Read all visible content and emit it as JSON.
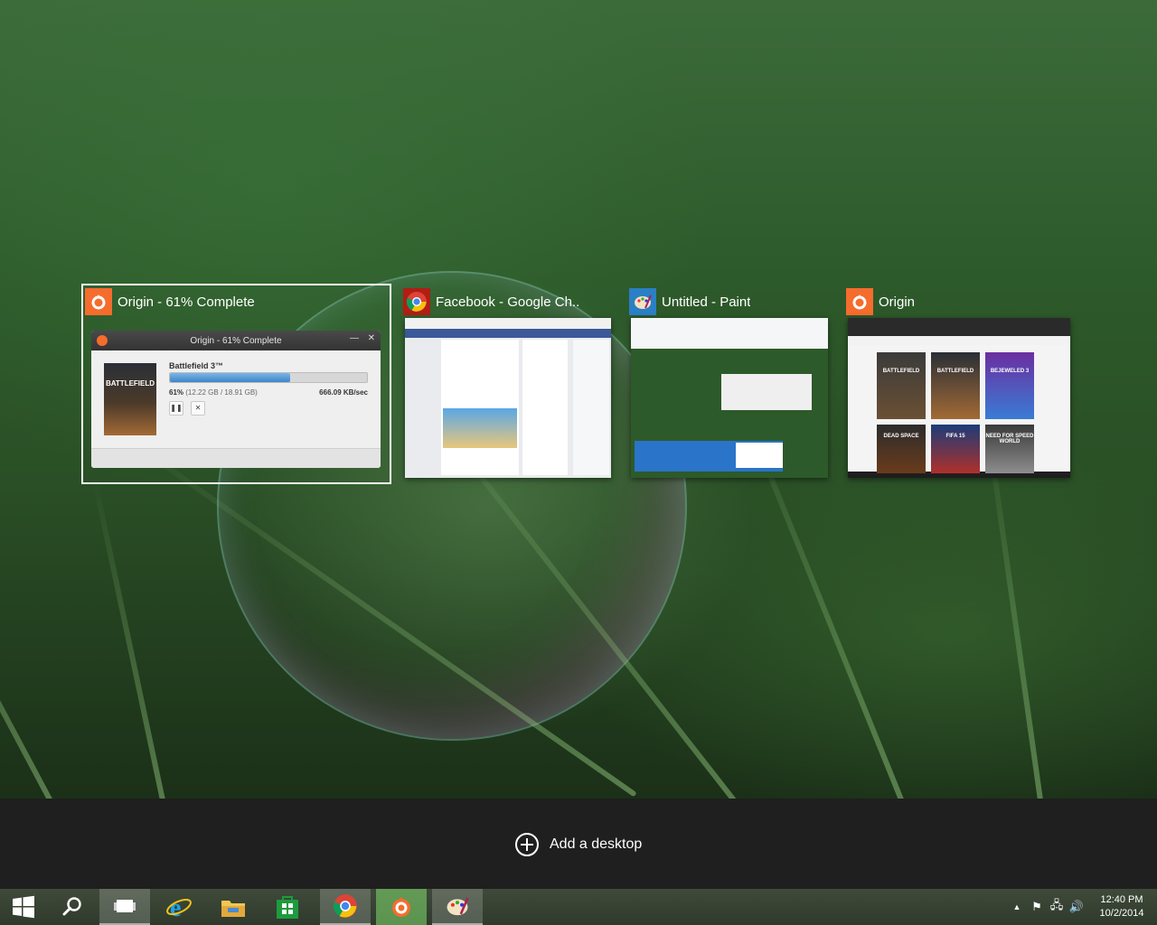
{
  "task_view": {
    "windows": [
      {
        "title": "Origin - 61% Complete",
        "app": "Origin",
        "selected": true
      },
      {
        "title": "Facebook - Google Ch...",
        "app": "Google Chrome",
        "selected": false
      },
      {
        "title": "Untitled - Paint",
        "app": "Paint",
        "selected": false
      },
      {
        "title": "Origin",
        "app": "Origin",
        "selected": false
      }
    ],
    "origin_dialog": {
      "title": "Origin - 61% Complete",
      "game": "Battlefield 3™",
      "cover_text": "BATTLEFIELD",
      "percent_text": "61%",
      "size_text": "(12.22 GB / 18.91 GB)",
      "speed": "666.09 KB/sec",
      "progress": 0.61,
      "min_glyph": "—",
      "close_glyph": "✕",
      "pause_glyph": "❚❚",
      "cancel_glyph": "✕"
    },
    "origin_library": {
      "covers": [
        "BATTLEFIELD",
        "BATTLEFIELD",
        "BEJEWELED 3",
        "DEAD SPACE",
        "FIFA 15",
        "NEED FOR SPEED WORLD"
      ]
    }
  },
  "add_desktop": {
    "label": "Add a desktop"
  },
  "taskbar": {
    "items": [
      {
        "name": "start",
        "icon": "windows-logo-icon"
      },
      {
        "name": "search",
        "icon": "search-icon"
      },
      {
        "name": "task-view",
        "icon": "task-view-icon"
      },
      {
        "name": "internet-explorer",
        "icon": "internet-explorer-icon"
      },
      {
        "name": "file-explorer",
        "icon": "folder-icon"
      },
      {
        "name": "store",
        "icon": "store-icon"
      },
      {
        "name": "chrome",
        "icon": "chrome-icon"
      },
      {
        "name": "origin",
        "icon": "origin-icon"
      },
      {
        "name": "paint",
        "icon": "paint-icon"
      }
    ],
    "tray": {
      "time": "12:40 PM",
      "date": "10/2/2014",
      "show_hidden_glyph": "▲",
      "flag_glyph": "⚑",
      "network_glyph": "🖧",
      "volume_glyph": "🔊"
    }
  },
  "colors": {
    "origin_orange": "#f56c2d",
    "taskbar": "#2f3a2c",
    "add_bar": "#1f1f1f",
    "store_green": "#1e9b3e"
  }
}
